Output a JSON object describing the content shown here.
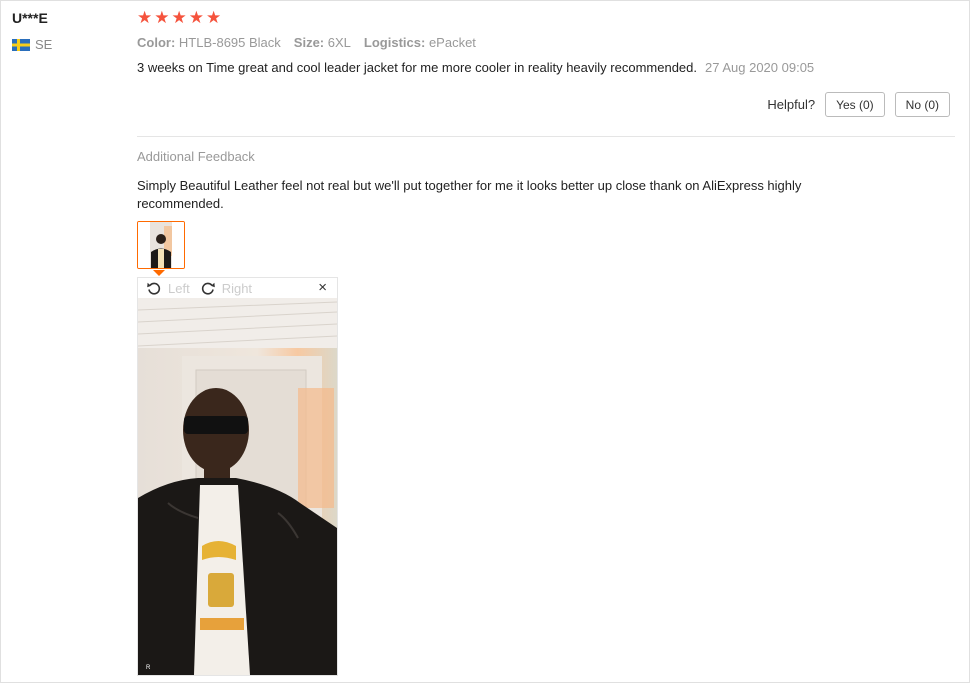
{
  "user": {
    "name": "U***E",
    "country_code": "SE"
  },
  "rating": {
    "stars": 5,
    "max": 5
  },
  "attributes": [
    {
      "key": "Color:",
      "value": "HTLB-8695 Black"
    },
    {
      "key": "Size:",
      "value": "6XL"
    },
    {
      "key": "Logistics:",
      "value": "ePacket"
    }
  ],
  "review": {
    "text": "3 weeks on Time great and cool leader jacket for me more cooler in reality heavily recommended.",
    "date": "27 Aug 2020 09:05"
  },
  "helpful": {
    "label": "Helpful?",
    "yes_label": "Yes (0)",
    "no_label": "No (0)"
  },
  "additional": {
    "title": "Additional Feedback",
    "text": "Simply Beautiful Leather feel not real but we'll put together for me it looks better up close thank on AliExpress highly recommended."
  },
  "viewer": {
    "rotate_left_label": "Left",
    "rotate_right_label": "Right",
    "close_glyph": "×"
  },
  "colors": {
    "star": "#f5533d",
    "accent": "#ff6a00",
    "muted": "#999999"
  },
  "icons": {
    "flag": "sweden-flag-icon",
    "rotate_left": "rotate-left-icon",
    "rotate_right": "rotate-right-icon",
    "close": "close-icon"
  }
}
